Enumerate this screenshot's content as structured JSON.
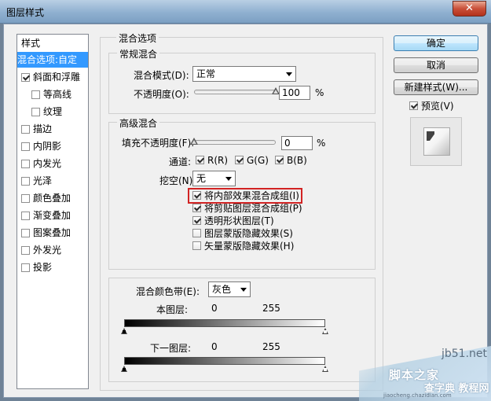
{
  "window": {
    "title": "图层样式",
    "close_glyph": "✕"
  },
  "style_list": {
    "header": "样式",
    "items": [
      {
        "label": "混合选项:自定",
        "selected": true,
        "checkbox": false,
        "checked": false
      },
      {
        "label": "斜面和浮雕",
        "checkbox": true,
        "checked": true
      },
      {
        "label": "等高线",
        "checkbox": true,
        "checked": false,
        "indent": true
      },
      {
        "label": "纹理",
        "checkbox": true,
        "checked": false,
        "indent": true
      },
      {
        "label": "描边",
        "checkbox": true,
        "checked": false
      },
      {
        "label": "内阴影",
        "checkbox": true,
        "checked": false
      },
      {
        "label": "内发光",
        "checkbox": true,
        "checked": false
      },
      {
        "label": "光泽",
        "checkbox": true,
        "checked": false
      },
      {
        "label": "颜色叠加",
        "checkbox": true,
        "checked": false
      },
      {
        "label": "渐变叠加",
        "checkbox": true,
        "checked": false
      },
      {
        "label": "图案叠加",
        "checkbox": true,
        "checked": false
      },
      {
        "label": "外发光",
        "checkbox": true,
        "checked": false
      },
      {
        "label": "投影",
        "checkbox": true,
        "checked": false
      }
    ]
  },
  "blending_options": {
    "title": "混合选项",
    "general": {
      "title": "常规混合",
      "blend_mode_label": "混合模式(D):",
      "blend_mode_value": "正常",
      "opacity_label": "不透明度(O):",
      "opacity_value": "100",
      "opacity_level": 100,
      "percent": "%"
    },
    "advanced": {
      "title": "高级混合",
      "fill_opacity_label": "填充不透明度(F):",
      "fill_opacity_value": "0",
      "fill_opacity_level": 0,
      "percent": "%",
      "channels_label": "通道:",
      "channels": [
        {
          "label": "R(R)",
          "checked": true
        },
        {
          "label": "G(G)",
          "checked": true
        },
        {
          "label": "B(B)",
          "checked": true
        }
      ],
      "knockout_label": "挖空(N):",
      "knockout_value": "无",
      "options": [
        {
          "label": "将内部效果混合成组(I)",
          "checked": true,
          "highlighted": true
        },
        {
          "label": "将剪贴图层混合成组(P)",
          "checked": true
        },
        {
          "label": "透明形状图层(T)",
          "checked": true
        },
        {
          "label": "图层蒙版隐藏效果(S)",
          "checked": false
        },
        {
          "label": "矢量蒙版隐藏效果(H)",
          "checked": false
        }
      ]
    },
    "blend_if": {
      "label": "混合颜色带(E):",
      "value": "灰色",
      "this_layer_label": "本图层:",
      "this_layer_min": "0",
      "this_layer_max": "255",
      "underlying_label": "下一图层:",
      "underlying_min": "0",
      "underlying_max": "255"
    }
  },
  "buttons": {
    "ok": "确定",
    "cancel": "取消",
    "new_style": "新建样式(W)...",
    "preview_label": "预览(V)",
    "preview_checked": true
  },
  "watermark": {
    "line1": "jb51.net",
    "line2": "脚本之家",
    "line3": "查字典 教程网",
    "line4": "jiaocheng.chazidian.com"
  },
  "colors": {
    "selection": "#3399ff",
    "highlight_border": "#d22323",
    "default_button": "#bee6fd"
  }
}
